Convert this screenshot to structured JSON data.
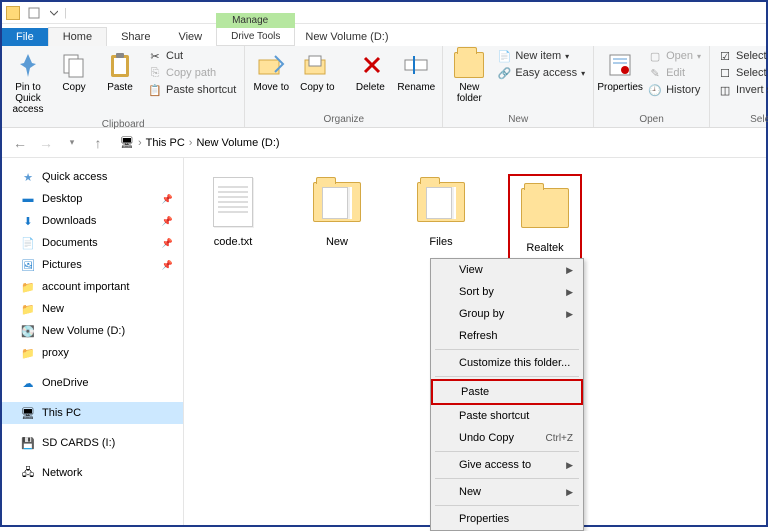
{
  "window": {
    "title": "New Volume (D:)"
  },
  "tabs": {
    "file": "File",
    "home": "Home",
    "share": "Share",
    "view": "View",
    "manage": "Manage",
    "drive_tools": "Drive Tools"
  },
  "ribbon": {
    "clipboard": {
      "label": "Clipboard",
      "pin": "Pin to Quick access",
      "copy": "Copy",
      "paste": "Paste",
      "cut": "Cut",
      "copy_path": "Copy path",
      "paste_shortcut": "Paste shortcut"
    },
    "organize": {
      "label": "Organize",
      "move_to": "Move to",
      "copy_to": "Copy to",
      "delete": "Delete",
      "rename": "Rename"
    },
    "new": {
      "label": "New",
      "new_folder": "New folder",
      "new_item": "New item",
      "easy_access": "Easy access"
    },
    "open": {
      "label": "Open",
      "properties": "Properties",
      "open": "Open",
      "edit": "Edit",
      "history": "History"
    },
    "select": {
      "label": "Select",
      "select_all": "Select all",
      "select_none": "Select none",
      "invert": "Invert selection"
    }
  },
  "breadcrumb": {
    "this_pc": "This PC",
    "volume": "New Volume (D:)"
  },
  "sidebar": {
    "quick_access": "Quick access",
    "desktop": "Desktop",
    "downloads": "Downloads",
    "documents": "Documents",
    "pictures": "Pictures",
    "account_important": "account important",
    "new": "New",
    "new_volume": "New Volume (D:)",
    "proxy": "proxy",
    "onedrive": "OneDrive",
    "this_pc": "This PC",
    "sd_cards": "SD CARDS (I:)",
    "network": "Network"
  },
  "files": {
    "code": "code.txt",
    "new": "New",
    "files": "Files",
    "realtek": "Realtek"
  },
  "context_menu": {
    "view": "View",
    "sort_by": "Sort by",
    "group_by": "Group by",
    "refresh": "Refresh",
    "customize": "Customize this folder...",
    "paste": "Paste",
    "paste_shortcut": "Paste shortcut",
    "undo_copy": "Undo Copy",
    "undo_shortcut": "Ctrl+Z",
    "give_access": "Give access to",
    "new": "New",
    "properties": "Properties"
  }
}
